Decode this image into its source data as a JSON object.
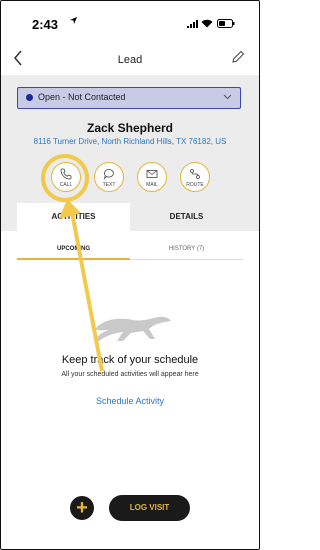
{
  "status_bar": {
    "time": "2:43"
  },
  "header": {
    "title": "Lead"
  },
  "lead_status": {
    "value": "Open - Not Contacted"
  },
  "contact": {
    "name": "Zack Shepherd",
    "address": "8116 Turner Drive, North Richland Hills, TX 76182, US"
  },
  "actions": [
    {
      "label": "CALL",
      "icon": "phone-icon"
    },
    {
      "label": "TEXT",
      "icon": "chat-bubble-icon"
    },
    {
      "label": "MAIL",
      "icon": "envelope-icon"
    },
    {
      "label": "ROUTE",
      "icon": "route-icon"
    }
  ],
  "tabs": [
    {
      "label": "ACTIVITIES",
      "active": true
    },
    {
      "label": "DETAILS",
      "active": false
    }
  ],
  "subtabs": [
    {
      "label": "UPCOMING",
      "active": true
    },
    {
      "label": "HISTORY (7)",
      "active": false
    }
  ],
  "empty_state": {
    "title": "Keep track of your schedule",
    "subtitle": "All your scheduled activities will appear here",
    "link": "Schedule Activity"
  },
  "footer": {
    "add_label": "+",
    "log_visit_label": "LOG VISIT"
  },
  "colors": {
    "accent": "#e5b53a",
    "status_fill": "#c8cbe6",
    "status_border": "#3b47b7",
    "link": "#2a78c4",
    "button_bg": "#1a1a1a"
  }
}
